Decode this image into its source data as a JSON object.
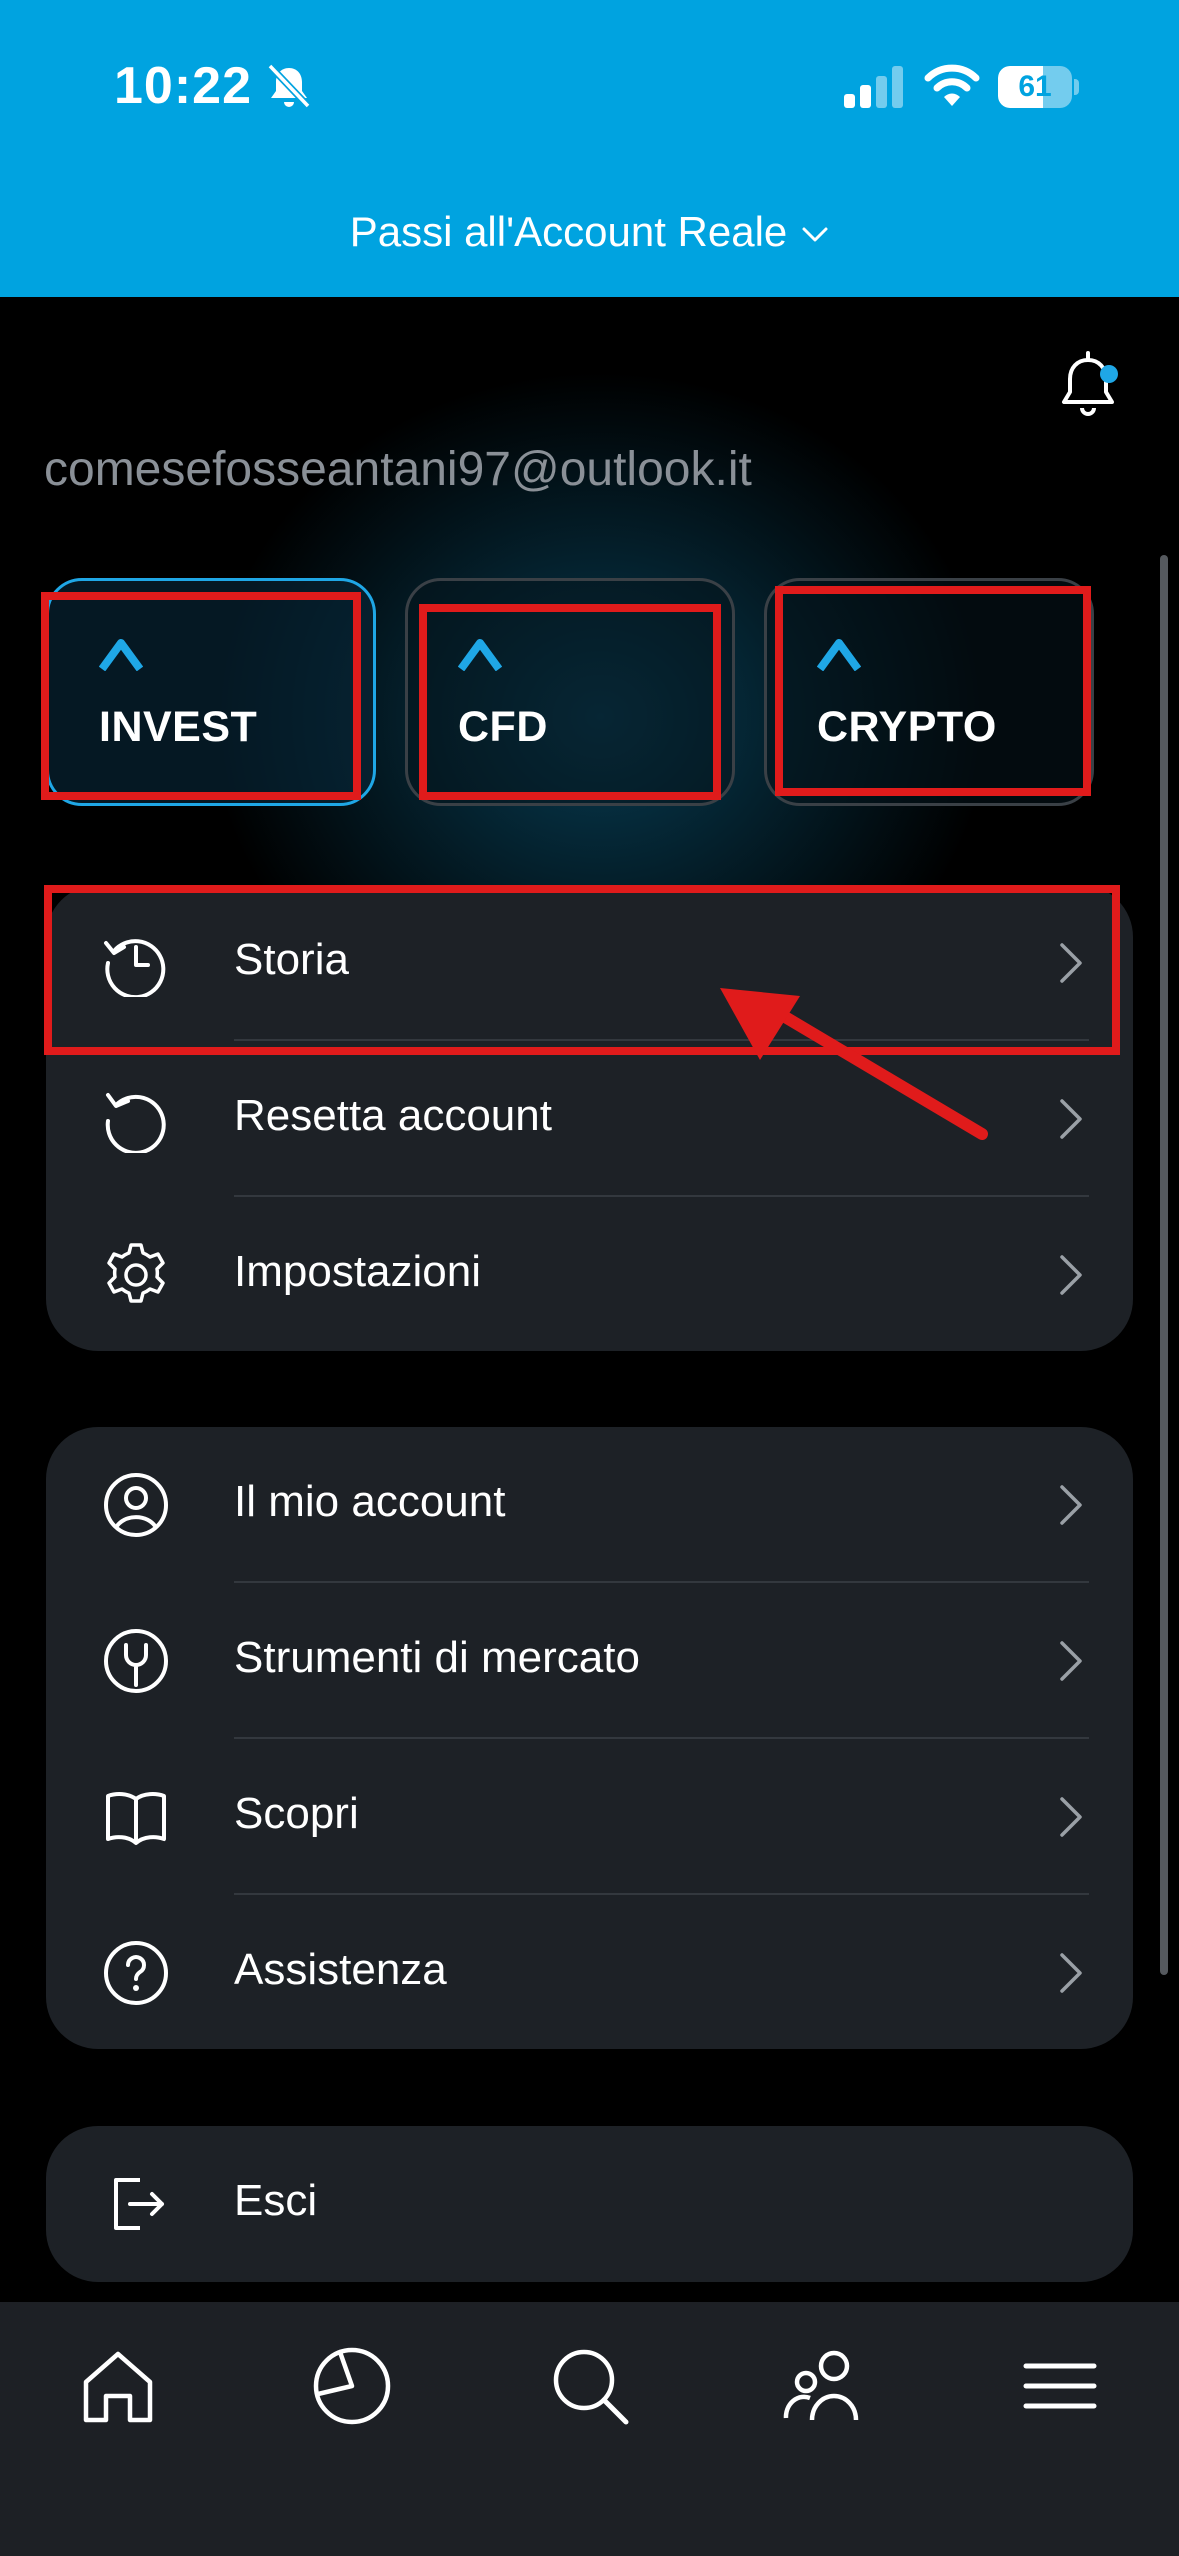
{
  "status_bar": {
    "time": "10:22",
    "battery": "61",
    "battery_level": 0.61
  },
  "header": {
    "switch_account_label": "Passi all'Account Reale"
  },
  "user": {
    "email": "comesefosseantani97@outlook.it"
  },
  "account_types": [
    {
      "label": "INVEST"
    },
    {
      "label": "CFD"
    },
    {
      "label": "CRYPTO"
    }
  ],
  "menu_group_1": [
    {
      "label": "Storia",
      "icon": "history-icon"
    },
    {
      "label": "Resetta account",
      "icon": "reset-icon"
    },
    {
      "label": "Impostazioni",
      "icon": "gear-icon"
    }
  ],
  "menu_group_2": [
    {
      "label": "Il mio account",
      "icon": "user-circle-icon"
    },
    {
      "label": "Strumenti di mercato",
      "icon": "tools-icon"
    },
    {
      "label": "Scopri",
      "icon": "book-icon"
    },
    {
      "label": "Assistenza",
      "icon": "help-icon"
    }
  ],
  "menu_group_3": [
    {
      "label": "Esci",
      "icon": "logout-icon"
    }
  ],
  "tabbar": [
    "home-icon",
    "portfolio-icon",
    "search-icon",
    "community-icon",
    "menu-icon"
  ],
  "colors": {
    "header_bg": "#00a3e0",
    "accent": "#1fa7e6",
    "annotation": "#e01b1b",
    "card_bg": "#1d2126"
  }
}
